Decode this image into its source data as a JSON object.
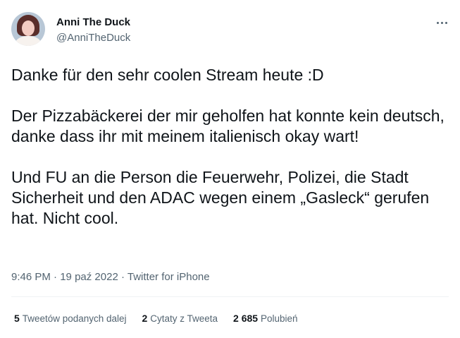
{
  "author": {
    "display_name": "Anni The Duck",
    "handle": "@AnniTheDuck"
  },
  "more_icon": "ellipsis-icon",
  "tweet": {
    "text": "Danke für den sehr coolen Stream heute :D\n\nDer Pizzabäckerei der mir geholfen hat konnte kein deutsch, danke dass ihr mit meinem italienisch okay wart!\n\nUnd FU an die Person die Feuerwehr, Polizei, die Stadt Sicherheit und den ADAC wegen einem „Gasleck“ gerufen hat. Nicht cool."
  },
  "meta": {
    "time": "9:46 PM",
    "separator": "·",
    "date": "19 paź 2022",
    "source": "Twitter for iPhone"
  },
  "stats": {
    "retweets": {
      "count": "5",
      "label": "Tweetów podanych dalej"
    },
    "quotes": {
      "count": "2",
      "label": "Cytaty z Tweeta"
    },
    "likes": {
      "count": "2 685",
      "label": "Polubień"
    }
  },
  "colors": {
    "text": "#0f1419",
    "secondary": "#536471",
    "divider": "#eff3f4"
  }
}
